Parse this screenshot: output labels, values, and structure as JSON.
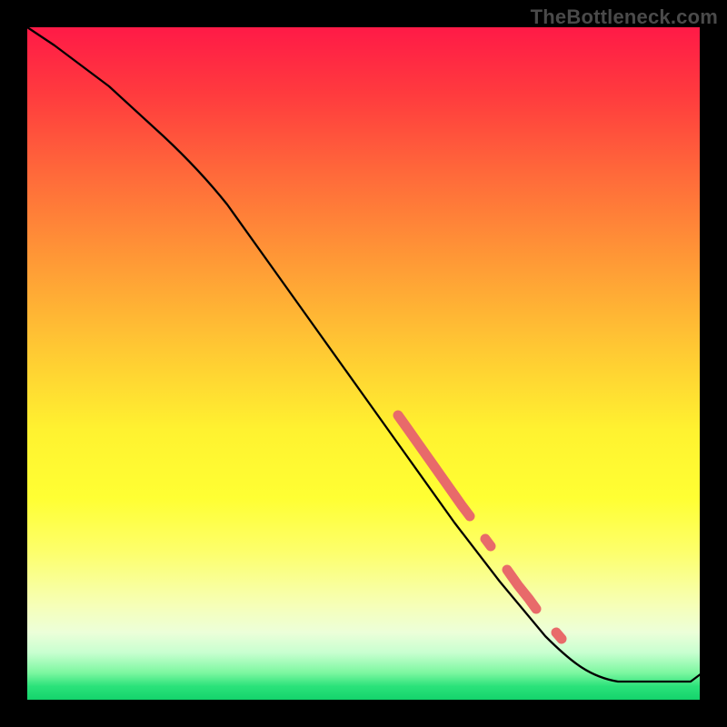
{
  "watermark": "TheBottleneck.com",
  "chart_data": {
    "type": "line",
    "title": "",
    "xlabel": "",
    "ylabel": "",
    "xlim": [
      0,
      100
    ],
    "ylim": [
      0,
      100
    ],
    "background": "spectral-vertical-gradient",
    "series": [
      {
        "name": "bottleneck-curve",
        "x": [
          0,
          5,
          25,
          30,
          40,
          50,
          60,
          65,
          70,
          75,
          80,
          85,
          90,
          95,
          100
        ],
        "y": [
          100,
          97,
          80,
          74,
          60,
          46,
          32,
          25,
          19,
          13,
          7,
          4,
          3,
          3,
          5
        ]
      }
    ],
    "highlights": [
      {
        "name": "segment-1",
        "x_start": 58,
        "x_end": 68,
        "thick": true
      },
      {
        "name": "dot-1",
        "x_start": 70,
        "x_end": 71,
        "thick": true
      },
      {
        "name": "segment-2",
        "x_start": 73,
        "x_end": 77,
        "thick": true
      },
      {
        "name": "dot-2",
        "x_start": 80,
        "x_end": 81,
        "thick": true
      }
    ],
    "colors": {
      "curve": "#000000",
      "highlight": "#e86a6a",
      "gradient_top": "#ff1a47",
      "gradient_bottom": "#14d46c",
      "frame": "#000000"
    }
  }
}
